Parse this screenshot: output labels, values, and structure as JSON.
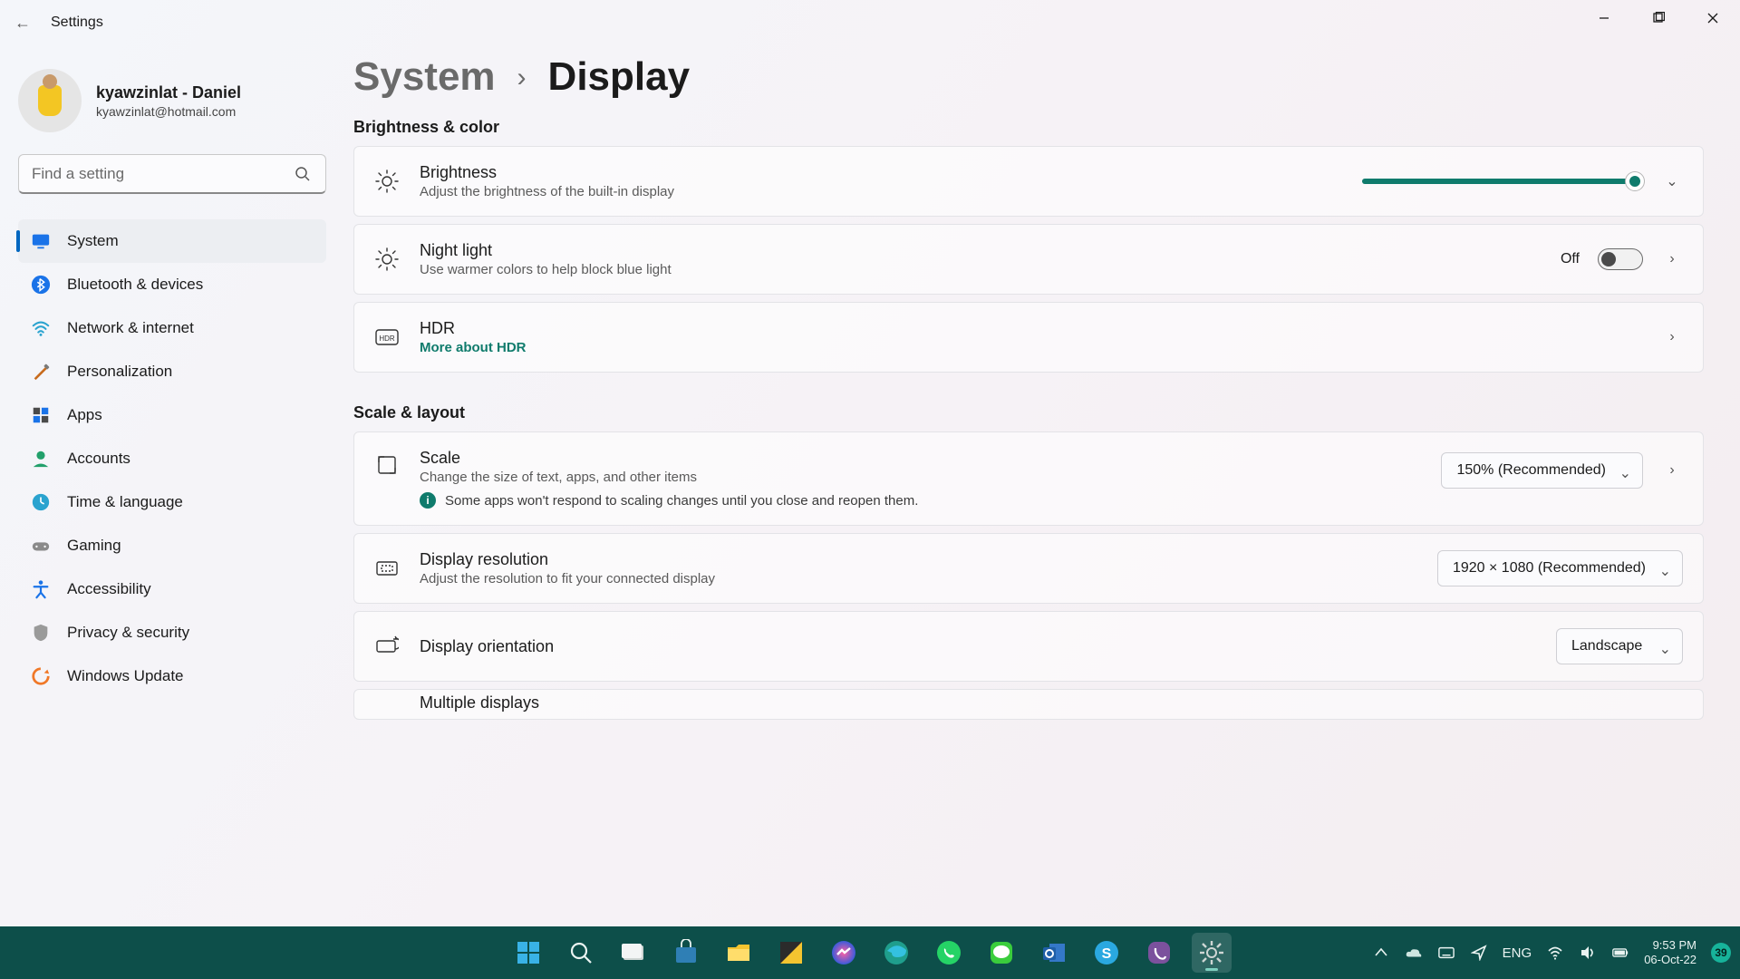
{
  "window": {
    "app_title": "Settings"
  },
  "profile": {
    "name": "kyawzinlat - Daniel",
    "email": "kyawzinlat@hotmail.com"
  },
  "search": {
    "placeholder": "Find a setting"
  },
  "sidebar": {
    "items": [
      {
        "label": "System"
      },
      {
        "label": "Bluetooth & devices"
      },
      {
        "label": "Network & internet"
      },
      {
        "label": "Personalization"
      },
      {
        "label": "Apps"
      },
      {
        "label": "Accounts"
      },
      {
        "label": "Time & language"
      },
      {
        "label": "Gaming"
      },
      {
        "label": "Accessibility"
      },
      {
        "label": "Privacy & security"
      },
      {
        "label": "Windows Update"
      }
    ]
  },
  "breadcrumb": {
    "parent": "System",
    "sep": "›",
    "current": "Display"
  },
  "sections": {
    "brightness_color": "Brightness & color",
    "scale_layout": "Scale & layout"
  },
  "brightness": {
    "title": "Brightness",
    "sub": "Adjust the brightness of the built-in display",
    "value_pct": 97
  },
  "nightlight": {
    "title": "Night light",
    "sub": "Use warmer colors to help block blue light",
    "state_label": "Off",
    "on": false
  },
  "hdr": {
    "title": "HDR",
    "link": "More about HDR"
  },
  "scale": {
    "title": "Scale",
    "sub": "Change the size of text, apps, and other items",
    "info": "Some apps won't respond to scaling changes until you close and reopen them.",
    "value": "150% (Recommended)"
  },
  "resolution": {
    "title": "Display resolution",
    "sub": "Adjust the resolution to fit your connected display",
    "value": "1920 × 1080 (Recommended)"
  },
  "orientation": {
    "title": "Display orientation",
    "value": "Landscape"
  },
  "multiple_displays": {
    "title": "Multiple displays"
  },
  "tray": {
    "lang": "ENG",
    "time": "9:53 PM",
    "date": "06-Oct-22",
    "badge": "39"
  }
}
